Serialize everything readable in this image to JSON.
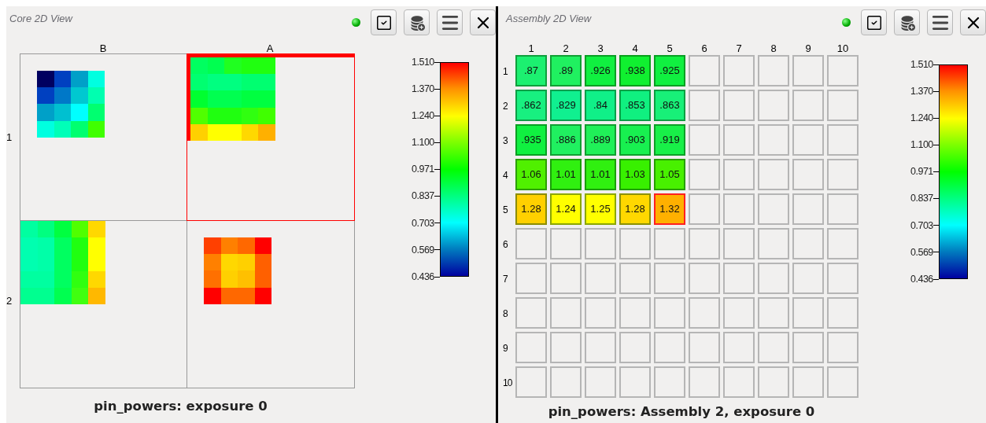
{
  "core_view": {
    "title": "Core 2D View",
    "status_on": true,
    "column_labels": [
      "B",
      "A"
    ],
    "row_labels": [
      "1",
      "2"
    ],
    "assemblies": [
      {
        "selected": false,
        "cells": [
          [
            {
              "color": "#000060"
            },
            {
              "color": "#0040c0"
            },
            {
              "color": "#00a0c8"
            },
            {
              "color": "#00ffe0"
            }
          ],
          [
            {
              "color": "#0040c0"
            },
            {
              "color": "#0078c8"
            },
            {
              "color": "#00c8d0"
            },
            {
              "color": "#00ffb0"
            }
          ],
          [
            {
              "color": "#00a0c8"
            },
            {
              "color": "#00c0d0"
            },
            {
              "color": "#00ffff"
            },
            {
              "color": "#00ff70"
            }
          ],
          [
            {
              "color": "#00ffe0"
            },
            {
              "color": "#00ffb8"
            },
            {
              "color": "#00ff70"
            },
            {
              "color": "#40ff00"
            }
          ]
        ]
      },
      {
        "selected": true,
        "cells": [
          [
            {
              "color": "#00ff60"
            },
            {
              "color": "#00ff50"
            },
            {
              "color": "#20ff20"
            },
            {
              "color": "#20ff10"
            },
            {
              "color": "#20ff10"
            }
          ],
          [
            {
              "color": "#00ff70"
            },
            {
              "color": "#00ff80"
            },
            {
              "color": "#00ff80"
            },
            {
              "color": "#00ff70"
            },
            {
              "color": "#00ff70"
            }
          ],
          [
            {
              "color": "#00ff30"
            },
            {
              "color": "#00ff50"
            },
            {
              "color": "#00ff50"
            },
            {
              "color": "#00ff40"
            },
            {
              "color": "#00ff40"
            }
          ],
          [
            {
              "color": "#50ff00"
            },
            {
              "color": "#20ff10"
            },
            {
              "color": "#20ff10"
            },
            {
              "color": "#30ff10"
            },
            {
              "color": "#40ff00"
            }
          ],
          [
            {
              "color": "#ffd000"
            },
            {
              "color": "#ffff00"
            },
            {
              "color": "#ffff00"
            },
            {
              "color": "#ffd800"
            },
            {
              "color": "#ffb000"
            }
          ]
        ]
      },
      {
        "selected": false,
        "cells": [
          [
            {
              "color": "#00ffa0"
            },
            {
              "color": "#00ff80"
            },
            {
              "color": "#00ff40"
            },
            {
              "color": "#50ff00"
            },
            {
              "color": "#ffd800"
            }
          ],
          [
            {
              "color": "#00ffb0"
            },
            {
              "color": "#00ffa8"
            },
            {
              "color": "#00ff60"
            },
            {
              "color": "#20ff10"
            },
            {
              "color": "#ffff00"
            }
          ],
          [
            {
              "color": "#00ffb0"
            },
            {
              "color": "#00ffa8"
            },
            {
              "color": "#00ff60"
            },
            {
              "color": "#20ff10"
            },
            {
              "color": "#ffff00"
            }
          ],
          [
            {
              "color": "#00ffa0"
            },
            {
              "color": "#00ffa0"
            },
            {
              "color": "#00ff60"
            },
            {
              "color": "#30ff10"
            },
            {
              "color": "#ffd800"
            }
          ],
          [
            {
              "color": "#00ff90"
            },
            {
              "color": "#00ff90"
            },
            {
              "color": "#00ff50"
            },
            {
              "color": "#40ff10"
            },
            {
              "color": "#ffb800"
            }
          ]
        ]
      },
      {
        "selected": false,
        "cells": [
          [
            {
              "color": "#ff4000"
            },
            {
              "color": "#ff8000"
            },
            {
              "color": "#ff6800"
            },
            {
              "color": "#ff0000"
            }
          ],
          [
            {
              "color": "#ff8000"
            },
            {
              "color": "#ffd800"
            },
            {
              "color": "#ffd000"
            },
            {
              "color": "#ff6000"
            }
          ],
          [
            {
              "color": "#ff7000"
            },
            {
              "color": "#ffd000"
            },
            {
              "color": "#ffc000"
            },
            {
              "color": "#ff6000"
            }
          ],
          [
            {
              "color": "#ff0000"
            },
            {
              "color": "#ff6800"
            },
            {
              "color": "#ff6800"
            },
            {
              "color": "#ff0000"
            }
          ]
        ]
      }
    ],
    "legend_ticks": [
      "1.510",
      "1.370",
      "1.240",
      "1.100",
      "0.971",
      "0.837",
      "0.703",
      "0.569",
      "0.436"
    ],
    "caption": "pin_powers: exposure 0"
  },
  "assembly_view": {
    "title": "Assembly 2D View",
    "status_on": true,
    "column_labels": [
      "1",
      "2",
      "3",
      "4",
      "5",
      "6",
      "7",
      "8",
      "9",
      "10"
    ],
    "rows": [
      {
        "label": "1",
        "cells": [
          {
            "value": ".87",
            "color": "#1cf070",
            "selected": false
          },
          {
            "value": ".89",
            "color": "#20f060",
            "selected": false
          },
          {
            "value": ".926",
            "color": "#10f040",
            "selected": false
          },
          {
            "value": ".938",
            "color": "#10f030",
            "selected": false
          },
          {
            "value": ".925",
            "color": "#10f040",
            "selected": false
          }
        ]
      },
      {
        "label": "2",
        "cells": [
          {
            "value": ".862",
            "color": "#18f080",
            "selected": false
          },
          {
            "value": ".829",
            "color": "#10f090",
            "selected": false
          },
          {
            "value": ".84",
            "color": "#10f088",
            "selected": false
          },
          {
            "value": ".853",
            "color": "#10f080",
            "selected": false
          },
          {
            "value": ".863",
            "color": "#18f078",
            "selected": false
          }
        ]
      },
      {
        "label": "3",
        "cells": [
          {
            "value": ".935",
            "color": "#10f040",
            "selected": false
          },
          {
            "value": ".886",
            "color": "#20f060",
            "selected": false
          },
          {
            "value": ".889",
            "color": "#20f058",
            "selected": false
          },
          {
            "value": ".903",
            "color": "#18f050",
            "selected": false
          },
          {
            "value": ".919",
            "color": "#18f048",
            "selected": false
          }
        ]
      },
      {
        "label": "4",
        "cells": [
          {
            "value": "1.06",
            "color": "#50f000",
            "selected": false
          },
          {
            "value": "1.01",
            "color": "#30f010",
            "selected": false
          },
          {
            "value": "1.01",
            "color": "#30f010",
            "selected": false
          },
          {
            "value": "1.03",
            "color": "#38f000",
            "selected": false
          },
          {
            "value": "1.05",
            "color": "#48f000",
            "selected": false
          }
        ]
      },
      {
        "label": "5",
        "cells": [
          {
            "value": "1.28",
            "color": "#ffd000",
            "selected": false
          },
          {
            "value": "1.24",
            "color": "#ffff00",
            "selected": false
          },
          {
            "value": "1.25",
            "color": "#ffff00",
            "selected": false
          },
          {
            "value": "1.28",
            "color": "#ffd800",
            "selected": false
          },
          {
            "value": "1.32",
            "color": "#ffb000",
            "selected": true
          }
        ]
      },
      {
        "label": "6"
      },
      {
        "label": "7"
      },
      {
        "label": "8"
      },
      {
        "label": "9"
      },
      {
        "label": "10"
      }
    ],
    "legend_ticks": [
      "1.510",
      "1.370",
      "1.240",
      "1.100",
      "0.971",
      "0.837",
      "0.703",
      "0.569",
      "0.436"
    ],
    "caption": "pin_powers: Assembly 2, exposure 0"
  }
}
